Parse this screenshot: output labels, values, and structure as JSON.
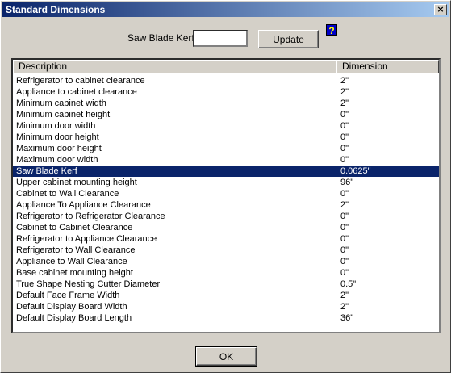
{
  "window": {
    "title": "Standard Dimensions",
    "close_label": "×"
  },
  "kerf": {
    "label": "Saw Blade Kerf",
    "value": "",
    "update_label": "Update",
    "help_label": "?"
  },
  "table": {
    "columns": [
      "Description",
      "Dimension"
    ],
    "selected_index": 8,
    "rows": [
      {
        "desc": "Refrigerator to cabinet clearance",
        "dim": "2\""
      },
      {
        "desc": "Appliance to cabinet clearance",
        "dim": "2\""
      },
      {
        "desc": "Minimum cabinet width",
        "dim": "2\""
      },
      {
        "desc": "Minimum cabinet height",
        "dim": "0\""
      },
      {
        "desc": "Minimum door width",
        "dim": "0\""
      },
      {
        "desc": "Minimum door height",
        "dim": "0\""
      },
      {
        "desc": "Maximum door height",
        "dim": "0\""
      },
      {
        "desc": "Maximum door width",
        "dim": "0\""
      },
      {
        "desc": "Saw Blade Kerf",
        "dim": "0.0625\""
      },
      {
        "desc": "Upper cabinet mounting height",
        "dim": "96\""
      },
      {
        "desc": "Cabinet to Wall Clearance",
        "dim": "0\""
      },
      {
        "desc": "Appliance To Appliance Clearance",
        "dim": "2\""
      },
      {
        "desc": "Refrigerator to Refrigerator Clearance",
        "dim": "0\""
      },
      {
        "desc": "Cabinet to Cabinet Clearance",
        "dim": "0\""
      },
      {
        "desc": "Refrigerator to Appliance Clearance",
        "dim": "0\""
      },
      {
        "desc": "Refrigerator to Wall Clearance",
        "dim": "0\""
      },
      {
        "desc": "Appliance to Wall Clearance",
        "dim": "0\""
      },
      {
        "desc": "Base cabinet mounting height",
        "dim": "0\""
      },
      {
        "desc": "True Shape Nesting Cutter Diameter",
        "dim": "0.5\""
      },
      {
        "desc": "Default Face Frame Width",
        "dim": "2\""
      },
      {
        "desc": "Default Display Board Width",
        "dim": "2\""
      },
      {
        "desc": "Default Display Board Length",
        "dim": "36\""
      }
    ]
  },
  "footer": {
    "ok_label": "OK"
  }
}
